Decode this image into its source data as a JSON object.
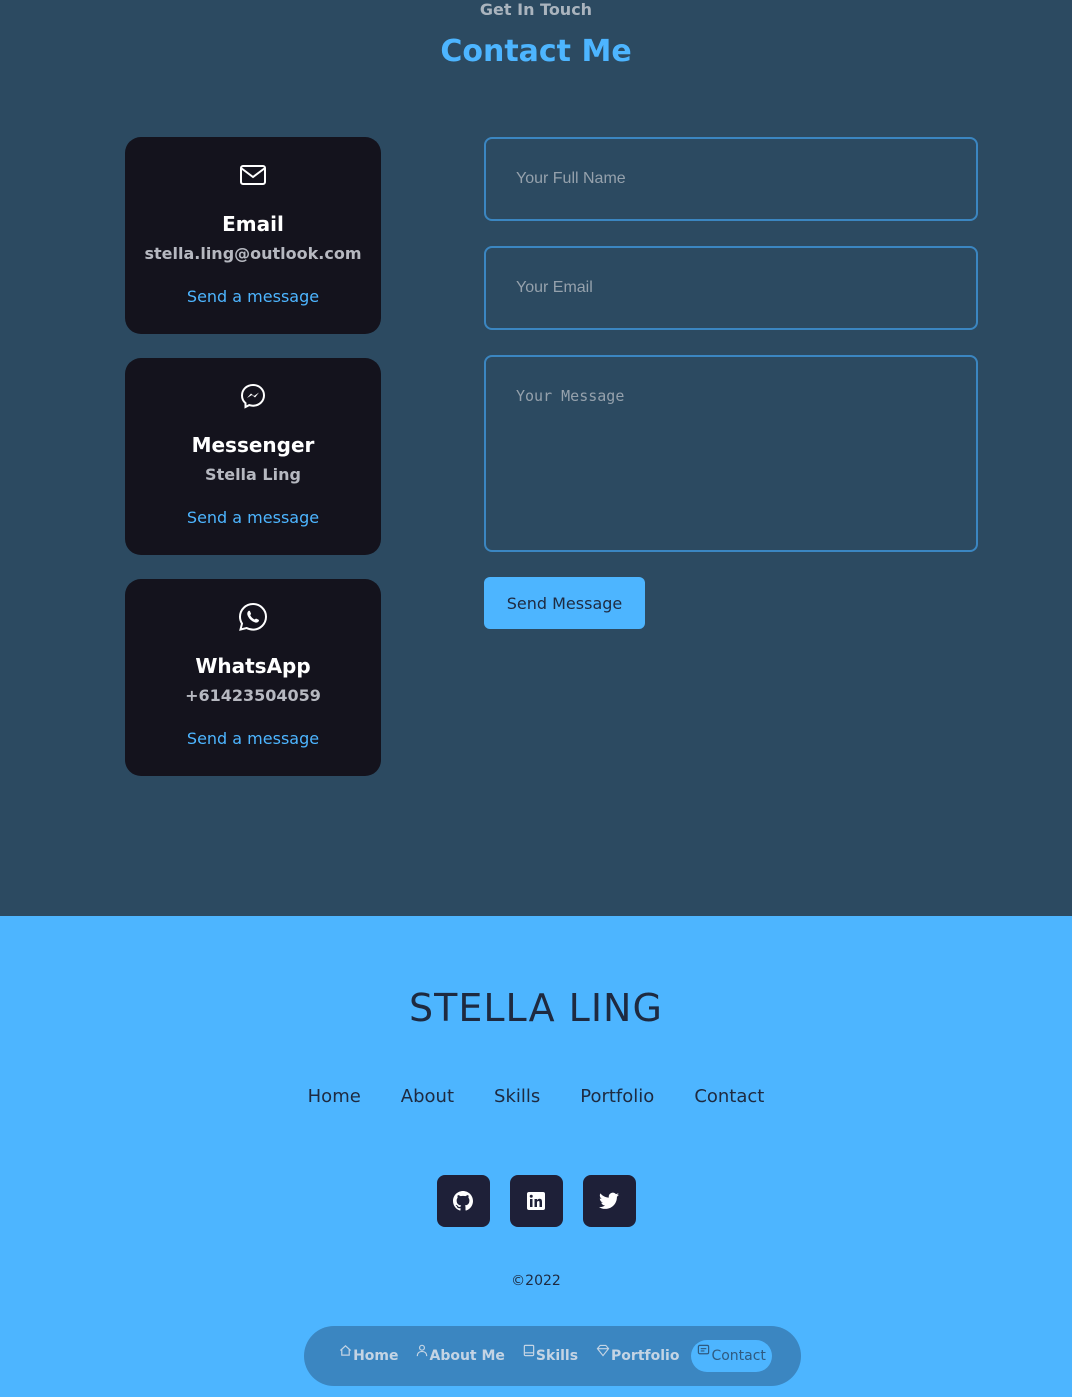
{
  "contact": {
    "subtitle": "Get In Touch",
    "title": "Contact Me",
    "cards": [
      {
        "icon": "mail-icon",
        "name": "Email",
        "value": "stella.ling@outlook.com",
        "link": "Send a message"
      },
      {
        "icon": "messenger-icon",
        "name": "Messenger",
        "value": "Stella Ling",
        "link": "Send a message"
      },
      {
        "icon": "whatsapp-icon",
        "name": "WhatsApp",
        "value": "+61423504059",
        "link": "Send a message"
      }
    ],
    "form": {
      "name_placeholder": "Your Full Name",
      "email_placeholder": "Your Email",
      "message_placeholder": "Your Message",
      "submit_label": "Send Message"
    }
  },
  "footer": {
    "brand": "STELLA LING",
    "links": [
      "Home",
      "About",
      "Skills",
      "Portfolio",
      "Contact"
    ],
    "socials": [
      "github-icon",
      "linkedin-icon",
      "twitter-icon"
    ],
    "copyright": "©2022"
  },
  "bottom_nav": {
    "items": [
      {
        "icon": "home-icon",
        "label": "Home"
      },
      {
        "icon": "user-icon",
        "label": "About Me"
      },
      {
        "icon": "book-icon",
        "label": "Skills"
      },
      {
        "icon": "portfolio-icon",
        "label": "Portfolio"
      },
      {
        "icon": "message-icon",
        "label": "Contact"
      }
    ],
    "active": "Contact"
  },
  "colors": {
    "accent": "#4db5ff",
    "section_bg": "#2c4a61",
    "card_bg": "#14131d",
    "dark_text": "#1e2a40"
  }
}
